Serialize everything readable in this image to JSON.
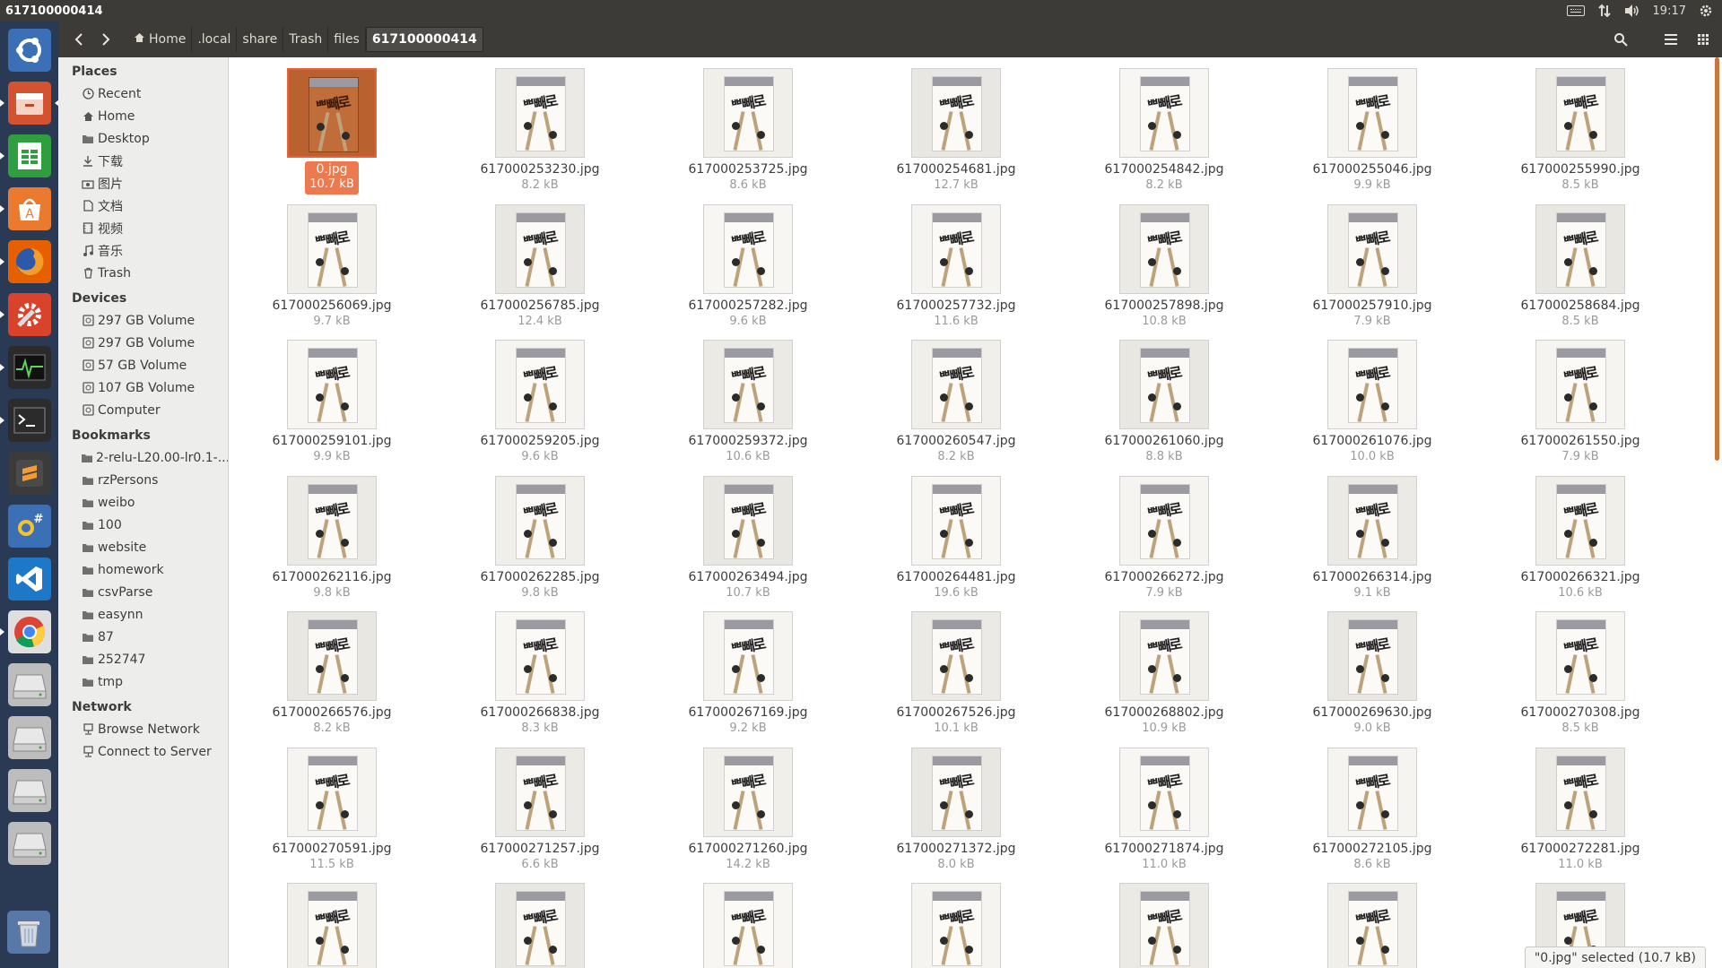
{
  "window_title": "617100000414",
  "panel": {
    "time": "19:17"
  },
  "launcher": {
    "apps": [
      {
        "name": "ubuntu-dash",
        "color": "#3b6fb6"
      },
      {
        "name": "files",
        "color": "#d3522f"
      },
      {
        "name": "libreoffice-calc",
        "color": "#2e9e3f"
      },
      {
        "name": "software-center",
        "color": "#ea7b2e"
      },
      {
        "name": "firefox",
        "color": "#e66000"
      },
      {
        "name": "system-settings",
        "color": "#d9432b"
      },
      {
        "name": "system-monitor",
        "color": "#2b2b2b"
      },
      {
        "name": "terminal",
        "color": "#2c2c2c"
      },
      {
        "name": "sublime-text",
        "color": "#3b3b3b"
      },
      {
        "name": "monodevelop",
        "color": "#3b6fb6"
      },
      {
        "name": "vscode",
        "color": "#1e78c8"
      },
      {
        "name": "chrome",
        "color": "#dfdfdf"
      },
      {
        "name": "drive",
        "color": "#bdbdbd"
      },
      {
        "name": "drive",
        "color": "#bdbdbd"
      },
      {
        "name": "drive",
        "color": "#bdbdbd"
      },
      {
        "name": "drive",
        "color": "#bdbdbd"
      }
    ]
  },
  "breadcrumb": [
    "Home",
    ".local",
    "share",
    "Trash",
    "files",
    "617100000414"
  ],
  "sidebar": {
    "places_title": "Places",
    "places": [
      {
        "label": "Recent",
        "icon": "clock-icon"
      },
      {
        "label": "Home",
        "icon": "home-icon"
      },
      {
        "label": "Desktop",
        "icon": "folder-icon"
      },
      {
        "label": "下载",
        "icon": "download-icon"
      },
      {
        "label": "图片",
        "icon": "camera-icon"
      },
      {
        "label": "文档",
        "icon": "document-icon"
      },
      {
        "label": "视频",
        "icon": "film-icon"
      },
      {
        "label": "音乐",
        "icon": "music-icon"
      },
      {
        "label": "Trash",
        "icon": "trash-icon"
      }
    ],
    "devices_title": "Devices",
    "devices": [
      {
        "label": "297 GB Volume"
      },
      {
        "label": "297 GB Volume"
      },
      {
        "label": "57 GB Volume"
      },
      {
        "label": "107 GB Volume"
      },
      {
        "label": "Computer"
      }
    ],
    "bookmarks_title": "Bookmarks",
    "bookmarks": [
      {
        "label": "2-relu-L20.00-lr0.1-..."
      },
      {
        "label": "rzPersons"
      },
      {
        "label": "weibo"
      },
      {
        "label": "100"
      },
      {
        "label": "website"
      },
      {
        "label": "homework"
      },
      {
        "label": "csvParse"
      },
      {
        "label": "easynn"
      },
      {
        "label": "87"
      },
      {
        "label": "252747"
      },
      {
        "label": "tmp"
      }
    ],
    "network_title": "Network",
    "network": [
      {
        "label": "Browse Network"
      },
      {
        "label": "Connect to Server"
      }
    ]
  },
  "files": [
    {
      "name": "0.jpg",
      "size": "10.7 kB",
      "selected": true
    },
    {
      "name": "617000253230.jpg",
      "size": "8.2 kB"
    },
    {
      "name": "617000253725.jpg",
      "size": "8.6 kB"
    },
    {
      "name": "617000254681.jpg",
      "size": "12.7 kB"
    },
    {
      "name": "617000254842.jpg",
      "size": "8.2 kB"
    },
    {
      "name": "617000255046.jpg",
      "size": "9.9 kB"
    },
    {
      "name": "617000255990.jpg",
      "size": "8.5 kB"
    },
    {
      "name": "617000256069.jpg",
      "size": "9.7 kB"
    },
    {
      "name": "617000256785.jpg",
      "size": "12.4 kB"
    },
    {
      "name": "617000257282.jpg",
      "size": "9.6 kB"
    },
    {
      "name": "617000257732.jpg",
      "size": "11.6 kB"
    },
    {
      "name": "617000257898.jpg",
      "size": "10.8 kB"
    },
    {
      "name": "617000257910.jpg",
      "size": "7.9 kB"
    },
    {
      "name": "617000258684.jpg",
      "size": "8.5 kB"
    },
    {
      "name": "617000259101.jpg",
      "size": "9.9 kB"
    },
    {
      "name": "617000259205.jpg",
      "size": "9.6 kB"
    },
    {
      "name": "617000259372.jpg",
      "size": "10.6 kB"
    },
    {
      "name": "617000260547.jpg",
      "size": "8.2 kB"
    },
    {
      "name": "617000261060.jpg",
      "size": "8.8 kB"
    },
    {
      "name": "617000261076.jpg",
      "size": "10.0 kB"
    },
    {
      "name": "617000261550.jpg",
      "size": "7.9 kB"
    },
    {
      "name": "617000262116.jpg",
      "size": "9.8 kB"
    },
    {
      "name": "617000262285.jpg",
      "size": "9.8 kB"
    },
    {
      "name": "617000263494.jpg",
      "size": "10.7 kB"
    },
    {
      "name": "617000264481.jpg",
      "size": "19.6 kB"
    },
    {
      "name": "617000266272.jpg",
      "size": "7.9 kB"
    },
    {
      "name": "617000266314.jpg",
      "size": "9.1 kB"
    },
    {
      "name": "617000266321.jpg",
      "size": "10.6 kB"
    },
    {
      "name": "617000266576.jpg",
      "size": "8.2 kB"
    },
    {
      "name": "617000266838.jpg",
      "size": "8.3 kB"
    },
    {
      "name": "617000267169.jpg",
      "size": "9.2 kB"
    },
    {
      "name": "617000267526.jpg",
      "size": "10.1 kB"
    },
    {
      "name": "617000268802.jpg",
      "size": "10.9 kB"
    },
    {
      "name": "617000269630.jpg",
      "size": "9.0 kB"
    },
    {
      "name": "617000270308.jpg",
      "size": "8.5 kB"
    },
    {
      "name": "617000270591.jpg",
      "size": "11.5 kB"
    },
    {
      "name": "617000271257.jpg",
      "size": "6.6 kB"
    },
    {
      "name": "617000271260.jpg",
      "size": "14.2 kB"
    },
    {
      "name": "617000271372.jpg",
      "size": "8.0 kB"
    },
    {
      "name": "617000271874.jpg",
      "size": "11.0 kB"
    },
    {
      "name": "617000272105.jpg",
      "size": "8.6 kB"
    },
    {
      "name": "617000272281.jpg",
      "size": "11.0 kB"
    },
    {
      "name": "",
      "size": ""
    },
    {
      "name": "",
      "size": ""
    },
    {
      "name": "",
      "size": ""
    },
    {
      "name": "",
      "size": ""
    },
    {
      "name": "",
      "size": ""
    },
    {
      "name": "",
      "size": ""
    },
    {
      "name": "",
      "size": ""
    }
  ],
  "status": "\"0.jpg\" selected (10.7 kB)"
}
